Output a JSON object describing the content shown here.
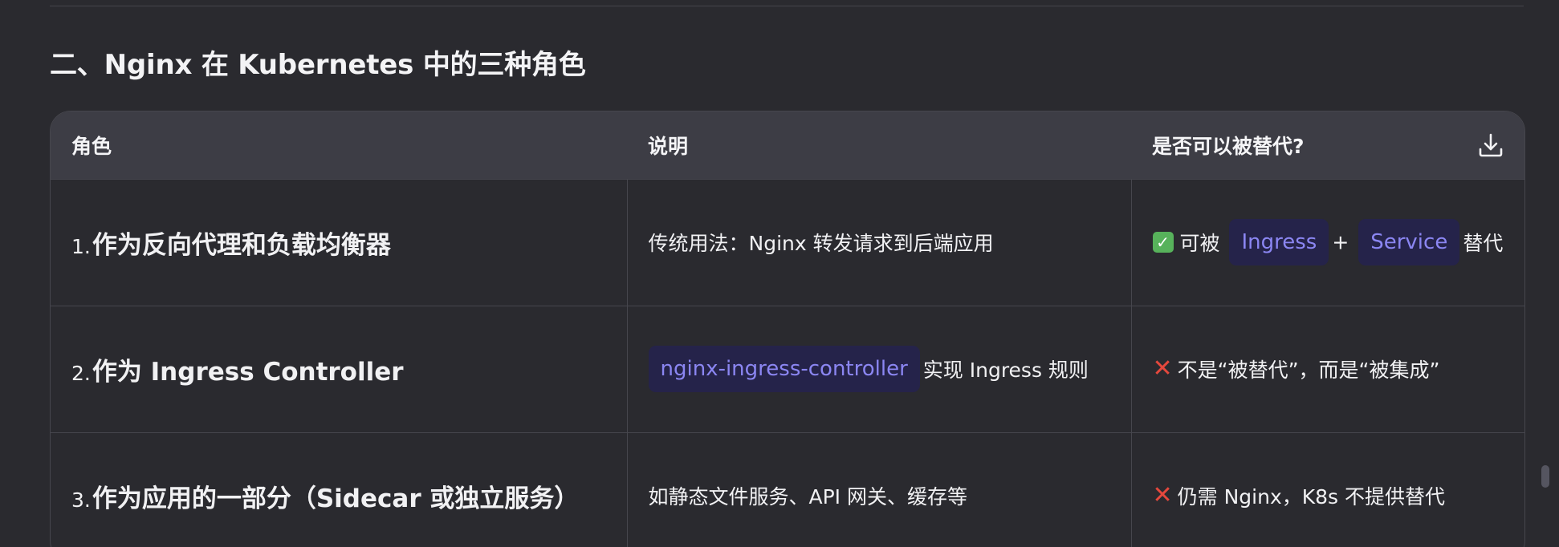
{
  "section": {
    "heading": "二、Nginx 在 Kubernetes 中的三种角色"
  },
  "table": {
    "headers": [
      "角色",
      "说明",
      "是否可以被替代?"
    ],
    "download_icon": "download-icon",
    "rows": [
      {
        "num": "1.",
        "role": "作为反向代理和负载均衡器",
        "desc_text": "传统用法：Nginx 转发请求到后端应用",
        "status_icon": "check-icon",
        "alt_prefix": "可被",
        "alt_code1": "Ingress",
        "alt_plus": "+",
        "alt_code2": "Service",
        "alt_suffix": "替代"
      },
      {
        "num": "2.",
        "role": "作为 Ingress Controller",
        "desc_code": "nginx-ingress-controller",
        "desc_text": "实现 Ingress 规则",
        "status_icon": "cross-icon",
        "alt_text": "不是“被替代”，而是“被集成”"
      },
      {
        "num": "3.",
        "role": "作为应用的一部分（Sidecar 或独立服务）",
        "desc_text": "如静态文件服务、API 网关、缓存等",
        "status_icon": "cross-icon",
        "alt_text": "仍需 Nginx，K8s 不提供替代"
      }
    ]
  },
  "colors": {
    "background": "#2a2a2f",
    "header_bg": "#3d3d45",
    "code_bg": "#25234a",
    "code_text": "#8b86f2",
    "check_green": "#57b25b",
    "cross_red": "#e5483d"
  }
}
